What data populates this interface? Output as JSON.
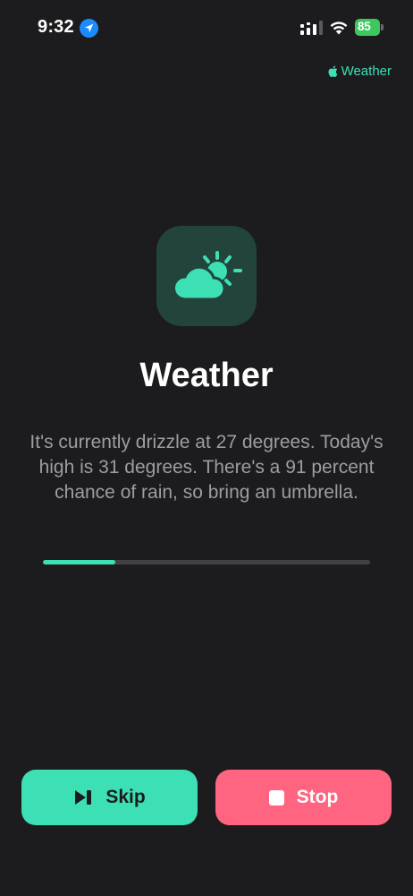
{
  "status_bar": {
    "time": "9:32",
    "battery": "85",
    "location_icon": "location-arrow-icon",
    "signal_icon": "cellular-signal-icon",
    "wifi_icon": "wifi-icon",
    "battery_icon": "battery-icon"
  },
  "source": {
    "label": "Weather",
    "icon": "apple-icon"
  },
  "app": {
    "title": "Weather",
    "icon": "weather-partly-cloudy-icon"
  },
  "message": "It's currently drizzle at 27 degrees. Today's high is 31 degrees. There's a 91 percent chance of rain, so bring an umbrella.",
  "progress": {
    "fraction": 0.22
  },
  "buttons": {
    "skip_label": "Skip",
    "stop_label": "Stop"
  },
  "colors": {
    "background": "#1c1c1e",
    "accent": "#3ddfb4",
    "stop": "#ff6481",
    "battery": "#3cc75f",
    "text_secondary": "#9d9da2"
  }
}
